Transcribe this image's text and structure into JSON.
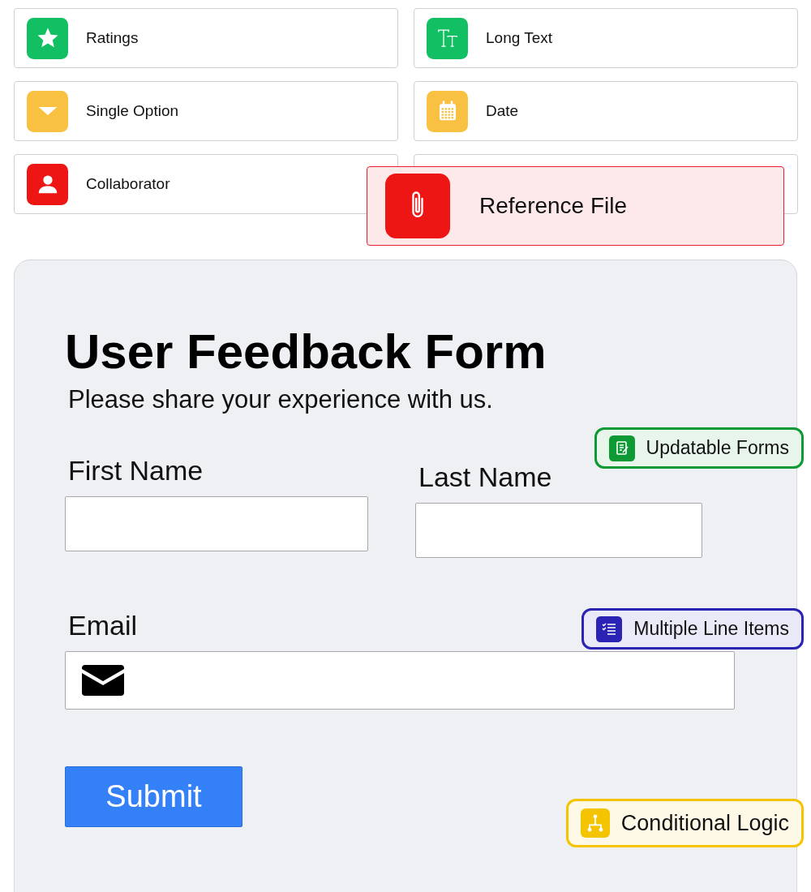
{
  "field_types": [
    {
      "label": "Ratings",
      "color": "#12bf62"
    },
    {
      "label": "Long Text",
      "color": "#12bf62"
    },
    {
      "label": "Single Option",
      "color": "#f8c141"
    },
    {
      "label": "Date",
      "color": "#f8c141"
    },
    {
      "label": "Collaborator",
      "color": "#ee1515"
    }
  ],
  "dragged_card": {
    "label": "Reference File",
    "color": "#ee1515"
  },
  "form": {
    "title": "User Feedback Form",
    "subtitle": "Please share your experience with us.",
    "fields": [
      {
        "label": "First Name",
        "kind": "text"
      },
      {
        "label": "Last Name",
        "kind": "text"
      },
      {
        "label": "Email",
        "kind": "email"
      }
    ],
    "submit": "Submit"
  },
  "feature_badges": [
    {
      "label": "Updatable Forms",
      "color": "#0d9a35"
    },
    {
      "label": "Multiple Line Items",
      "color": "#2a23b3"
    },
    {
      "label": "Conditional Logic",
      "color": "#f5c400"
    }
  ]
}
